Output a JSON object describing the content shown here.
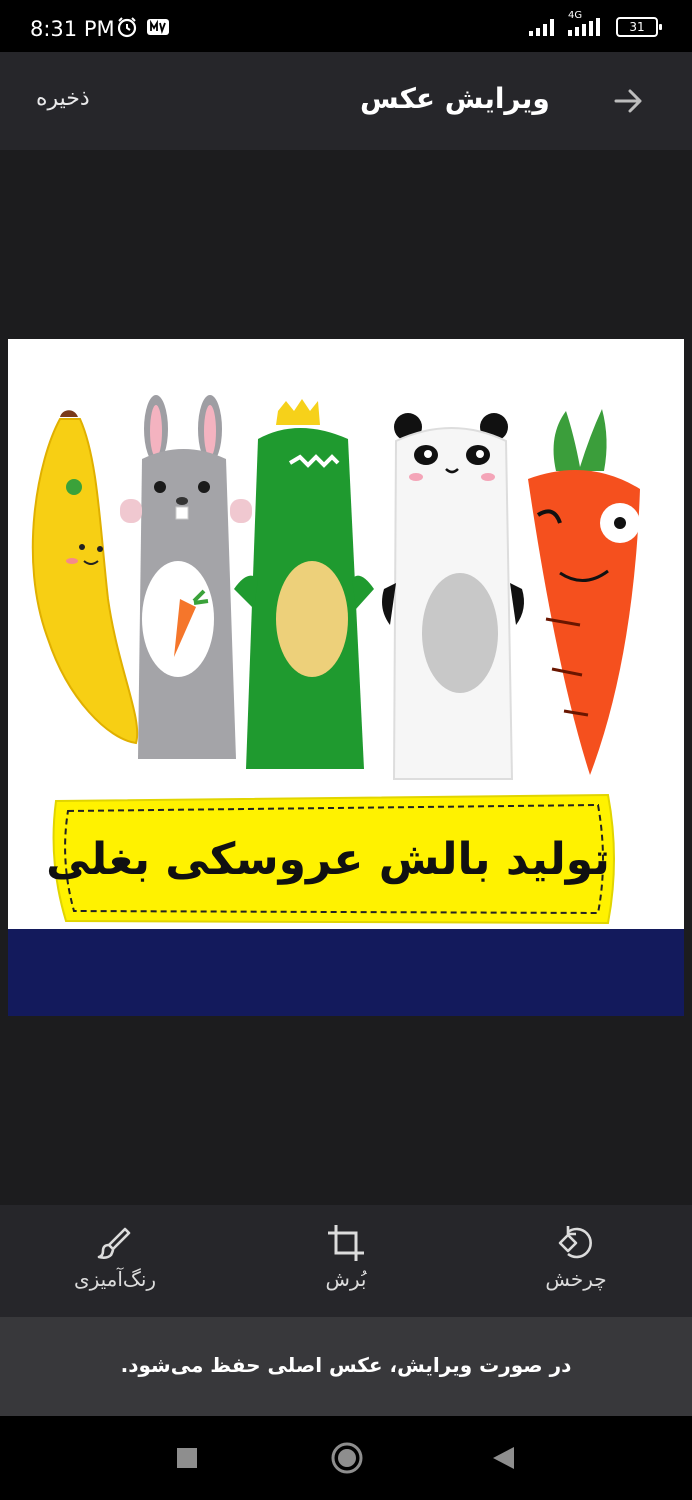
{
  "status_bar": {
    "time": "8:31 PM",
    "network": "4G",
    "battery": "31",
    "icons": [
      "alarm-icon",
      "media-icon",
      "signal-icon",
      "signal-4g-icon",
      "battery-icon"
    ]
  },
  "header": {
    "save_label": "ذخیره",
    "title": "ویرایش عکس",
    "back_icon": "arrow-right-icon"
  },
  "image": {
    "banner_text": "تولید بالش عروسکی بغلی",
    "toys": [
      "banana",
      "bunny",
      "dinosaur",
      "panda",
      "carrot"
    ],
    "colors": {
      "banner": "#fff200",
      "band": "#131a5c"
    }
  },
  "toolbar": {
    "tools": [
      {
        "label": "رنگ‌آمیزی",
        "icon": "brush-icon"
      },
      {
        "label": "بُرش",
        "icon": "crop-icon"
      },
      {
        "label": "چرخش",
        "icon": "rotate-icon"
      }
    ]
  },
  "notice": {
    "text": "در صورت ویرایش، عکس اصلی حفظ می‌شود."
  },
  "nav": {
    "icons": [
      "recents-square-icon",
      "home-circle-icon",
      "back-triangle-icon"
    ]
  },
  "colors": {
    "header_bg": "#26262a",
    "canvas_bg": "#1c1c1e",
    "notice_bg": "#38383b"
  }
}
